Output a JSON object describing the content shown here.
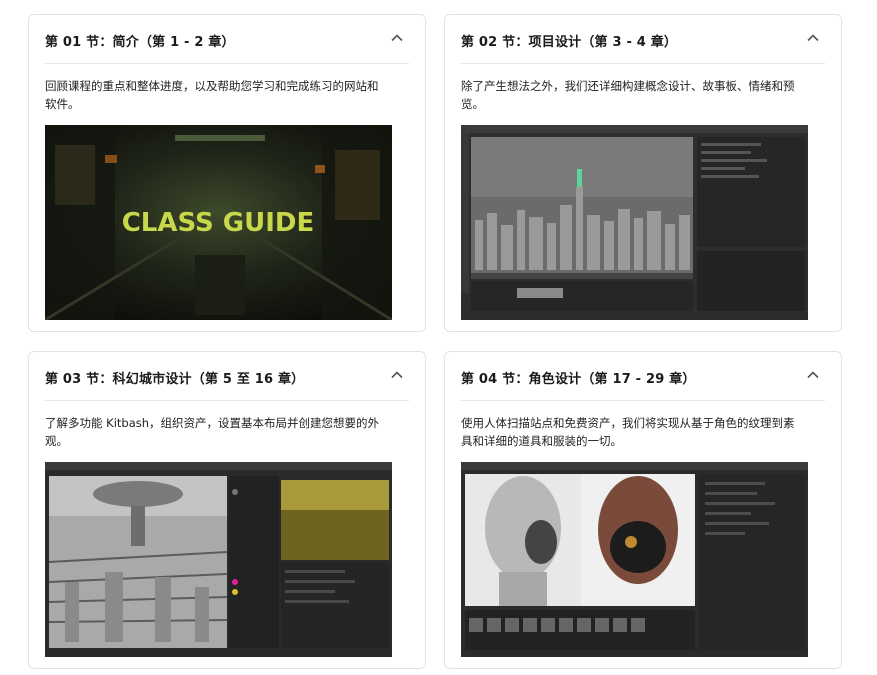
{
  "sections": [
    {
      "title": "第 01 节：简介（第 1 - 2 章）",
      "description": "回顾课程的重点和整体进度，以及帮助您学习和完成练习的网站和软件。",
      "thumb_caption": "CLASS GUIDE",
      "chevron_icon": "chevron-up-icon"
    },
    {
      "title": "第 02 节：项目设计（第 3 - 4 章）",
      "description": "除了产生想法之外，我们还详细构建概念设计、故事板、情绪和预览。",
      "chevron_icon": "chevron-up-icon"
    },
    {
      "title": "第 03 节：科幻城市设计（第 5 至 16 章）",
      "description": "了解多功能 Kitbash，组织资产，设置基本布局并创建您想要的外观。",
      "chevron_icon": "chevron-up-icon"
    },
    {
      "title": "第 04 节：角色设计（第 17 - 29 章）",
      "description": "使用人体扫描站点和免费资产，我们将实现从基于角色的纹理到素具和详细的道具和服装的一切。",
      "chevron_icon": "chevron-up-icon"
    }
  ],
  "colors": {
    "border": "#e3e3e3",
    "guide_text": "#c8d84a",
    "ui_dark": "#2b2b2b"
  }
}
